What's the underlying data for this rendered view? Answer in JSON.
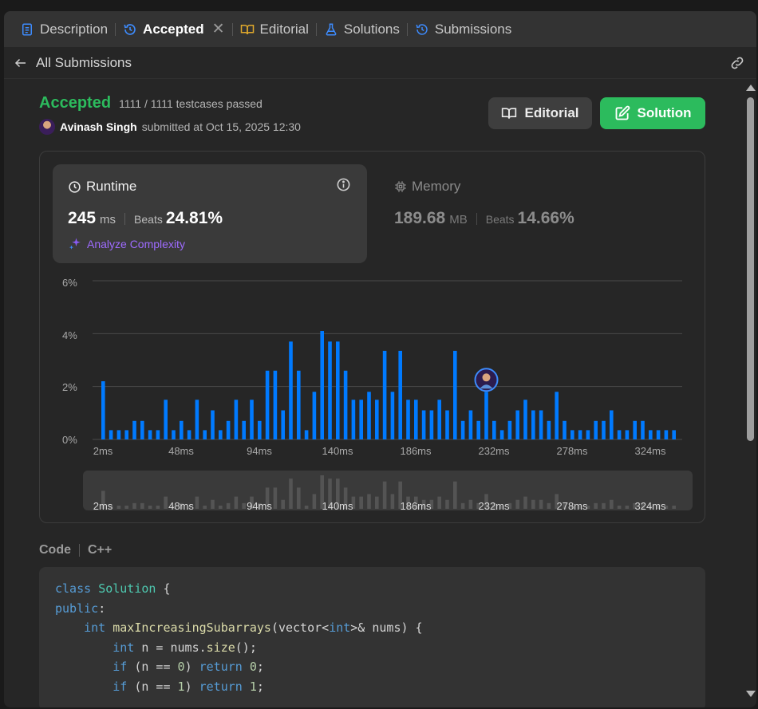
{
  "tabs": [
    {
      "label": "Description",
      "icon": "document-icon",
      "active": false
    },
    {
      "label": "Accepted",
      "icon": "history-icon",
      "active": true
    },
    {
      "label": "Editorial",
      "icon": "book-icon",
      "active": false
    },
    {
      "label": "Solutions",
      "icon": "flask-icon",
      "active": false
    },
    {
      "label": "Submissions",
      "icon": "history-icon",
      "active": false
    }
  ],
  "close_glyph": "✕",
  "nav": {
    "back_label": "All Submissions"
  },
  "submission": {
    "status": "Accepted",
    "testcases": "1111 / 1111 testcases passed",
    "author": "Avinash Singh",
    "submitted_text": "submitted at Oct 15, 2025 12:30"
  },
  "buttons": {
    "editorial": "Editorial",
    "solution": "Solution"
  },
  "runtime": {
    "title": "Runtime",
    "value": "245",
    "unit": "ms",
    "beats_label": "Beats",
    "beats": "24.81%",
    "analyze": "Analyze Complexity"
  },
  "memory": {
    "title": "Memory",
    "value": "189.68",
    "unit": "MB",
    "beats_label": "Beats",
    "beats": "14.66%"
  },
  "colors": {
    "accent_green": "#2cbb5d",
    "bar_blue": "#007aff",
    "analyze_purple": "#9e6bff"
  },
  "chart_data": {
    "type": "bar",
    "y_ticks": [
      "6%",
      "4%",
      "2%",
      "0%"
    ],
    "ylim": [
      0,
      6
    ],
    "x_tick_labels": [
      "2ms",
      "48ms",
      "94ms",
      "140ms",
      "186ms",
      "232ms",
      "278ms",
      "324ms"
    ],
    "grid": true,
    "values": [
      2.2,
      0.35,
      0.35,
      0.35,
      0.7,
      0.7,
      0.35,
      0.35,
      1.5,
      0.35,
      0.7,
      0.35,
      1.5,
      0.35,
      1.1,
      0.35,
      0.7,
      1.5,
      0.7,
      1.5,
      0.7,
      2.6,
      2.6,
      1.1,
      3.7,
      2.6,
      0.35,
      1.8,
      4.1,
      3.7,
      3.7,
      2.6,
      1.5,
      1.5,
      1.8,
      1.5,
      3.35,
      1.8,
      3.35,
      1.5,
      1.5,
      1.1,
      1.1,
      1.5,
      1.1,
      3.35,
      0.7,
      1.1,
      0.7,
      1.8,
      0.7,
      0.35,
      0.7,
      1.1,
      1.5,
      1.1,
      1.1,
      0.7,
      1.8,
      0.7,
      0.35,
      0.35,
      0.35,
      0.7,
      0.7,
      1.1,
      0.35,
      0.35,
      0.7,
      0.7,
      0.35,
      0.35,
      0.35,
      0.35
    ],
    "user_marker_index": 49
  },
  "code": {
    "title": "Code",
    "language": "C++",
    "lines": [
      [
        [
          "kw",
          "class"
        ],
        [
          "tx",
          " "
        ],
        [
          "ty",
          "Solution"
        ],
        [
          "tx",
          " {"
        ]
      ],
      [
        [
          "kw",
          "public"
        ],
        [
          "tx",
          ":"
        ]
      ],
      [
        [
          "tx",
          "    "
        ],
        [
          "kw",
          "int"
        ],
        [
          "tx",
          " "
        ],
        [
          "fn",
          "maxIncreasingSubarrays"
        ],
        [
          "tx",
          "(vector<"
        ],
        [
          "kw",
          "int"
        ],
        [
          "tx",
          ">& nums) {"
        ]
      ],
      [
        [
          "tx",
          "        "
        ],
        [
          "kw",
          "int"
        ],
        [
          "tx",
          " n = nums."
        ],
        [
          "fn",
          "size"
        ],
        [
          "tx",
          "();"
        ]
      ],
      [
        [
          "tx",
          "        "
        ],
        [
          "kw",
          "if"
        ],
        [
          "tx",
          " (n == "
        ],
        [
          "nm",
          "0"
        ],
        [
          "tx",
          ") "
        ],
        [
          "kw",
          "return"
        ],
        [
          "tx",
          " "
        ],
        [
          "nm",
          "0"
        ],
        [
          "tx",
          ";"
        ]
      ],
      [
        [
          "tx",
          "        "
        ],
        [
          "kw",
          "if"
        ],
        [
          "tx",
          " (n == "
        ],
        [
          "nm",
          "1"
        ],
        [
          "tx",
          ") "
        ],
        [
          "kw",
          "return"
        ],
        [
          "tx",
          " "
        ],
        [
          "nm",
          "1"
        ],
        [
          "tx",
          ";"
        ]
      ]
    ]
  }
}
